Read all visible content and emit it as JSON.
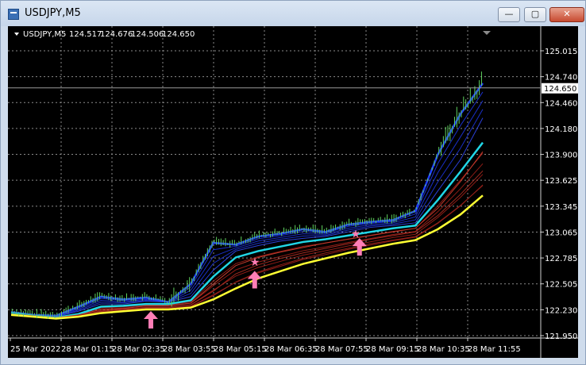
{
  "window": {
    "title": "USDJPY,M5",
    "controls": {
      "minimize": "—",
      "maximize": "▢",
      "close": "✕"
    }
  },
  "chart_header": {
    "symbol": "USDJPY,M5",
    "open": "124.517",
    "high": "124.676",
    "low": "124.506",
    "close": "124.650"
  },
  "current_price_label": "124.650",
  "colors": {
    "background": "#000000",
    "grid": "#8a8a8a",
    "candles": "#5fd35f",
    "ma_fast": "#1f3dff",
    "ma_mid": "#21d6e6",
    "ma_slow_bands": "#c0392b",
    "ma_slowest": "#ffff33",
    "signal_arrow": "#ff7eb6",
    "text": "#ffffff"
  },
  "chart_data": {
    "type": "line",
    "title": "USDJPY,M5",
    "x_tick_labels": [
      "25 Mar 2022",
      "28 Mar 01:15",
      "28 Mar 02:35",
      "28 Mar 03:55",
      "28 Mar 05:15",
      "28 Mar 06:35",
      "28 Mar 07:55",
      "28 Mar 09:15",
      "28 Mar 10:35",
      "28 Mar 11:55"
    ],
    "y_tick_labels": [
      "125.015",
      "124.740",
      "124.460",
      "124.180",
      "123.900",
      "123.625",
      "123.345",
      "123.065",
      "122.785",
      "122.505",
      "122.230",
      "121.950"
    ],
    "ylim": [
      121.95,
      125.17
    ],
    "price_line": 124.65,
    "x": [
      0,
      0.45,
      0.9,
      1.35,
      1.8,
      2.25,
      2.7,
      3.15,
      3.6,
      4.05,
      4.5,
      4.95,
      5.4,
      5.85,
      6.3,
      6.75,
      7.2,
      7.65,
      8.1,
      8.55,
      9.0,
      9.45
    ],
    "series": [
      {
        "values": [
          122.19,
          122.16,
          122.15,
          122.25,
          122.36,
          122.33,
          122.35,
          122.3,
          122.5,
          122.95,
          122.93,
          123.02,
          123.05,
          123.1,
          123.07,
          123.15,
          123.18,
          123.2,
          123.3,
          123.92,
          124.36,
          124.7
        ]
      },
      {
        "values": [
          122.18,
          122.16,
          122.14,
          122.2,
          122.28,
          122.28,
          122.31,
          122.3,
          122.36,
          122.65,
          122.86,
          122.92,
          122.97,
          123.0,
          123.02,
          123.07,
          123.12,
          123.14,
          123.17,
          123.52,
          123.86,
          124.32
        ]
      },
      {
        "values": [
          122.18,
          122.15,
          122.13,
          122.17,
          122.25,
          122.26,
          122.28,
          122.28,
          122.32,
          122.58,
          122.79,
          122.86,
          122.91,
          122.96,
          122.99,
          123.03,
          123.07,
          123.11,
          123.14,
          123.42,
          123.73,
          124.05
        ]
      },
      {
        "values": [
          122.17,
          122.15,
          122.13,
          122.16,
          122.22,
          122.23,
          122.26,
          122.26,
          122.29,
          122.5,
          122.7,
          122.79,
          122.85,
          122.9,
          122.95,
          122.99,
          123.03,
          123.07,
          123.11,
          123.33,
          123.62,
          123.95
        ]
      },
      {
        "values": [
          122.17,
          122.15,
          122.12,
          122.16,
          122.2,
          122.22,
          122.24,
          122.24,
          122.27,
          122.42,
          122.61,
          122.71,
          122.78,
          122.84,
          122.89,
          122.94,
          122.99,
          123.03,
          123.07,
          123.25,
          123.48,
          123.74
        ]
      },
      {
        "values": [
          122.17,
          122.14,
          122.12,
          122.15,
          122.19,
          122.21,
          122.23,
          122.23,
          122.25,
          122.37,
          122.52,
          122.63,
          122.71,
          122.78,
          122.84,
          122.89,
          122.94,
          122.98,
          123.02,
          123.17,
          123.36,
          123.58
        ]
      },
      {
        "values": [
          122.16,
          122.14,
          122.12,
          122.14,
          122.18,
          122.2,
          122.22,
          122.22,
          122.24,
          122.33,
          122.45,
          122.56,
          122.64,
          122.72,
          122.78,
          122.84,
          122.89,
          122.94,
          122.98,
          123.1,
          123.26,
          123.47
        ]
      }
    ],
    "signals": [
      {
        "type": "arrow-up",
        "x": 2.8,
        "y": 122.08
      },
      {
        "type": "arrow-up",
        "x": 4.88,
        "y": 122.52
      },
      {
        "type": "star",
        "x": 4.88,
        "y": 122.74
      },
      {
        "type": "arrow-up",
        "x": 6.98,
        "y": 122.88
      },
      {
        "type": "star",
        "x": 6.9,
        "y": 123.05
      }
    ]
  }
}
